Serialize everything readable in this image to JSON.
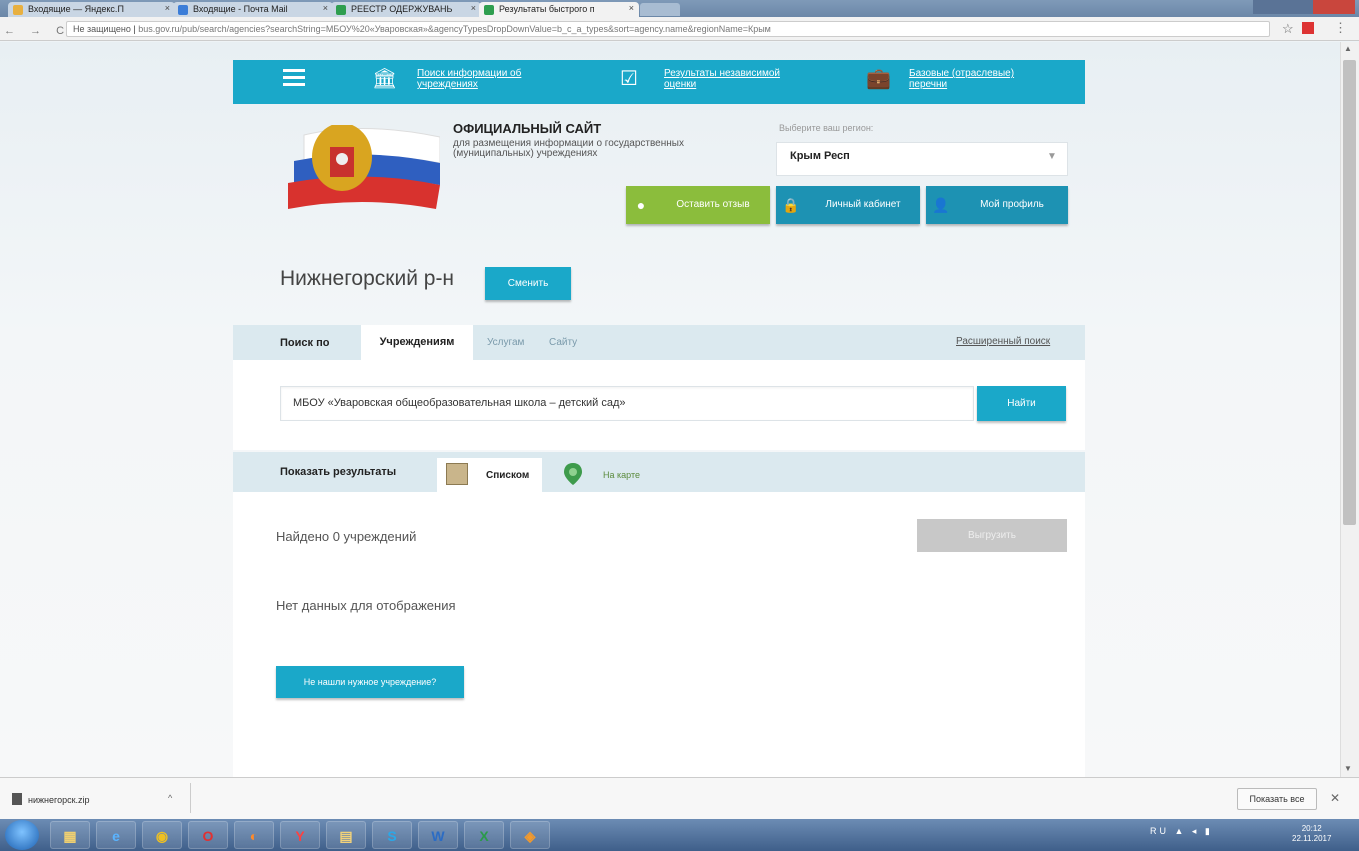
{
  "browser": {
    "tabs": [
      {
        "title": "Входящие — Яндекс.П",
        "favicon_color": "#e8b040"
      },
      {
        "title": "Входящие - Почта Mail",
        "favicon_color": "#3b7dd8"
      },
      {
        "title": "РЕЕСТР ОДЕРЖУВАНЬ",
        "favicon_color": "#2e9e4f"
      },
      {
        "title": "Результаты быстрого п",
        "favicon_color": "#2e9e4f"
      }
    ],
    "address_security": "Не защищено",
    "address_url": "bus.gov.ru/pub/search/agencies?searchString=МБОУ%20«Уваровская»&agencyTypesDropDownValue=b_c_a_types&sort=agency.name&regionName=Крым",
    "nav_glyphs": "← → C ⓘ"
  },
  "site_nav": {
    "items": [
      {
        "icon": "building-icon",
        "label": "Поиск информации об учреждениях"
      },
      {
        "icon": "checklist-icon",
        "label": "Результаты независимой оценки"
      },
      {
        "icon": "briefcase-icon",
        "label": "Базовые (отраслевые) перечни"
      }
    ]
  },
  "header": {
    "title": "ОФИЦИАЛЬНЫЙ САЙТ",
    "subtitle": "для размещения информации о государственных (муниципальных) учреждениях",
    "region_label": "Выберите ваш регион:",
    "region_value": "Крым Респ",
    "buttons": {
      "feedback": "Оставить отзыв",
      "cabinet": "Личный кабинет",
      "profile": "Мой профиль"
    }
  },
  "location": {
    "name": "Нижнегорский р-н",
    "change_label": "Сменить"
  },
  "search": {
    "search_by_label": "Поиск по",
    "tabs": [
      "Учреждениям",
      "Услугам",
      "Сайту"
    ],
    "advanced_link": "Расширенный поиск",
    "query": "МБОУ «Уваровская общеобразовательная школа – детский сад»",
    "find_label": "Найти"
  },
  "results": {
    "show_label": "Показать результаты",
    "list_label": "Списком",
    "map_label": "На карте",
    "found_text": "Найдено 0 учреждений",
    "export_label": "Выгрузить",
    "no_data_text": "Нет данных для отображения",
    "not_found_label": "Не нашли нужное учреждение?"
  },
  "download_bar": {
    "filename": "нижнегорск.zip",
    "show_all": "Показать все"
  },
  "taskbar": {
    "icons": [
      "explorer-icon",
      "ie-icon",
      "chrome-icon",
      "opera-icon",
      "firefox-icon",
      "yandex-icon",
      "folder-icon",
      "skype-icon",
      "word-icon",
      "excel-icon",
      "paint-icon"
    ],
    "tray": "RU ▲ ◂ ▮",
    "time": "20:12",
    "date": "22.11.2017"
  }
}
